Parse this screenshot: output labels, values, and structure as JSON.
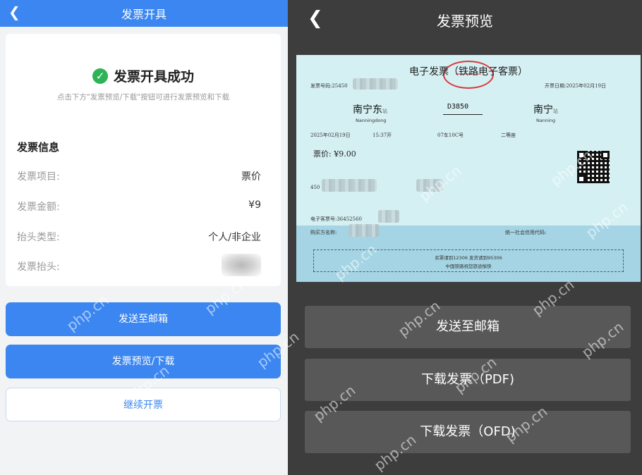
{
  "left": {
    "header": {
      "back_icon": "chevron-left-icon",
      "title": "发票开具"
    },
    "success": {
      "icon": "check-circle-icon",
      "title": "发票开具成功",
      "hint": "点击下方\"发票预览/下载\"按钮可进行发票预览和下载"
    },
    "info": {
      "section_title": "发票信息",
      "rows": [
        {
          "label": "发票项目:",
          "value": "票价"
        },
        {
          "label": "发票金额:",
          "value": "¥9"
        },
        {
          "label": "抬头类型:",
          "value": "个人/非企业"
        },
        {
          "label": "发票抬头:",
          "value": ""
        }
      ]
    },
    "buttons": {
      "send_email": "发送至邮箱",
      "preview_download": "发票预览/下载",
      "continue": "继续开票"
    },
    "colors": {
      "primary": "#3b86f0",
      "success": "#2eb356"
    }
  },
  "right": {
    "header": {
      "back_icon": "chevron-left-icon",
      "title": "发票预览"
    },
    "ticket": {
      "title": "电子发票（铁路电子客票）",
      "invoice_no_label": "发票号码:25450",
      "issue_date": "开票日期:2025年02月19日",
      "from_station": "南宁东",
      "from_suffix": "站",
      "from_pinyin": "Nanningdong",
      "train_no": "D3850",
      "to_station": "南宁",
      "to_suffix": "站",
      "to_pinyin": "Nanning",
      "depart_date": "2025年02月19日",
      "depart_time": "15:37开",
      "car_seat": "07车10C号",
      "seat_class": "二等座",
      "price": "票价: ¥9.00",
      "id_prefix": "450",
      "ticket_no_label": "电子客票号:36452560",
      "buyer_label": "购买方名称:",
      "credit_code_label": "统一社会信用代码:",
      "note_line1": "买票请到12306 发货请到95306",
      "note_line2": "中国铁路祝您旅途愉快"
    },
    "buttons": {
      "send_email": "发送至邮箱",
      "download_pdf": "下载发票（PDF)",
      "download_ofd": "下载发票（OFD)"
    }
  },
  "watermark": "php.cn"
}
